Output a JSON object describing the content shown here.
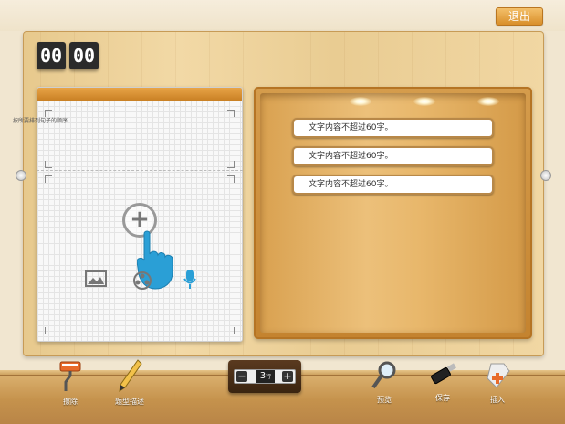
{
  "header": {
    "exit_label": "退出"
  },
  "timer": {
    "minutes": "00",
    "seconds": "00"
  },
  "left_panel": {
    "instruction": "按所要排列句子的顺序"
  },
  "right_panel": {
    "items": [
      "文字内容不超过60字。",
      "文字内容不超过60字。",
      "文字内容不超过60字。"
    ]
  },
  "stepper": {
    "value": "3",
    "unit": "行",
    "minus": "−",
    "plus": "+"
  },
  "toolbar": {
    "erase": "擦除",
    "sort_check": "题型描述",
    "preview": "预览",
    "save": "保存",
    "insert": "插入"
  },
  "colors": {
    "accent": "#d98f2a",
    "wood": "#e9cc92",
    "blue_hand": "#2a9fd6"
  }
}
